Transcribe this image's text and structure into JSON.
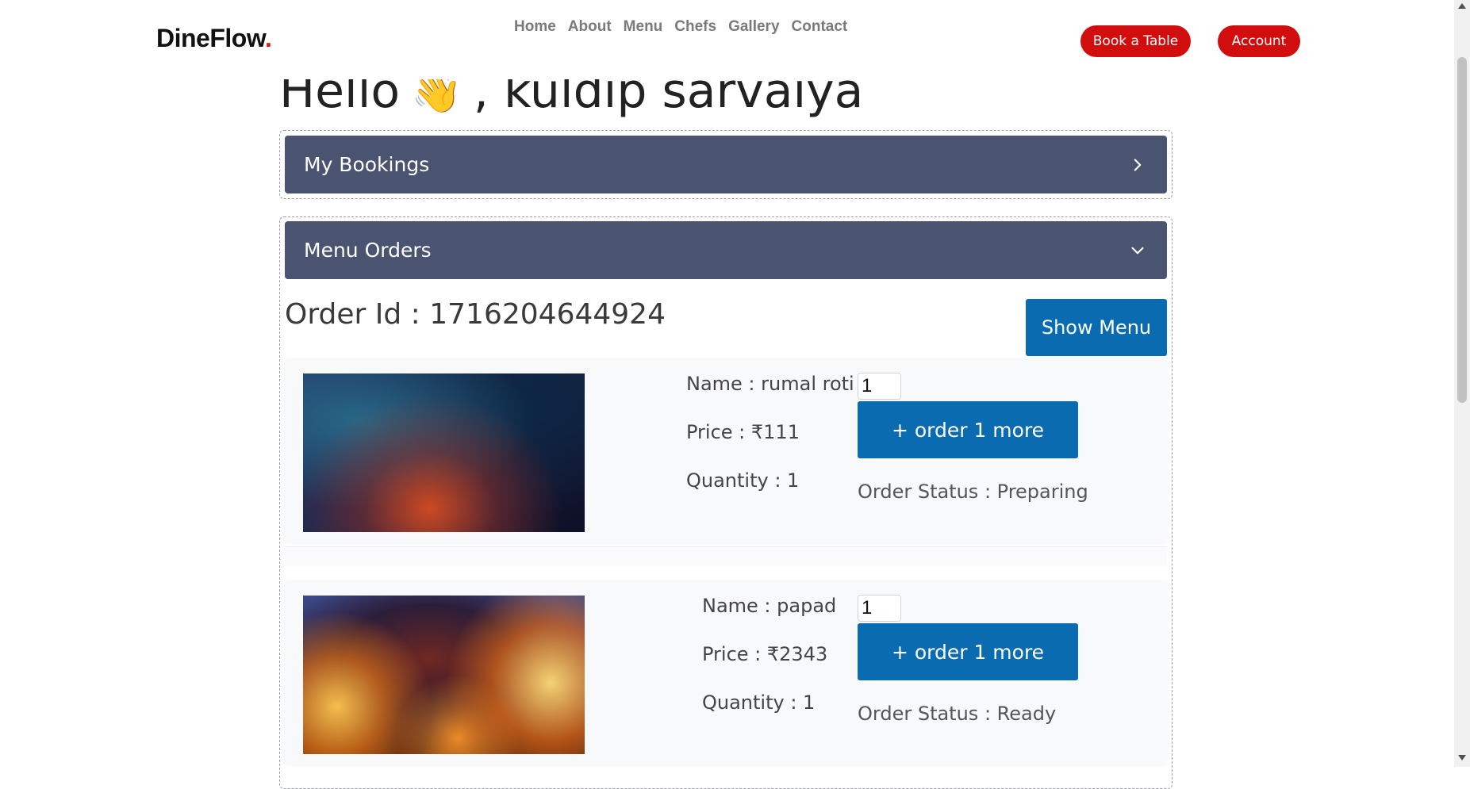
{
  "brand": {
    "name": "DineFlow",
    "dot": "."
  },
  "nav": {
    "items": [
      "Home",
      "About",
      "Menu",
      "Chefs",
      "Gallery",
      "Contact"
    ]
  },
  "header_buttons": {
    "book": "Book a Table",
    "account": "Account"
  },
  "greeting": {
    "hello": "Hello",
    "emoji": "👋",
    "name": ", kuldip sarvaiya"
  },
  "accordions": {
    "bookings": {
      "title": "My Bookings",
      "icon": "chevron-right-icon"
    },
    "orders": {
      "title": "Menu Orders",
      "icon": "chevron-down-icon"
    }
  },
  "order": {
    "id_label": "Order Id : 1716204644924",
    "show_menu": "Show Menu",
    "items": [
      {
        "name": "Name : rumal roti",
        "price": "Price : ₹111",
        "quantity": "Quantity : 1",
        "qty_value": "1",
        "order_more": "+ order 1 more",
        "status": "Order Status : Preparing"
      },
      {
        "name": "Name : papad",
        "price": "Price : ₹2343",
        "quantity": "Quantity : 1",
        "qty_value": "1",
        "order_more": "+ order 1 more",
        "status": "Order Status : Ready"
      }
    ]
  },
  "colors": {
    "accent_red": "#d20d0d",
    "primary_blue": "#0a6bb0",
    "accordion_header": "#4a5470"
  }
}
